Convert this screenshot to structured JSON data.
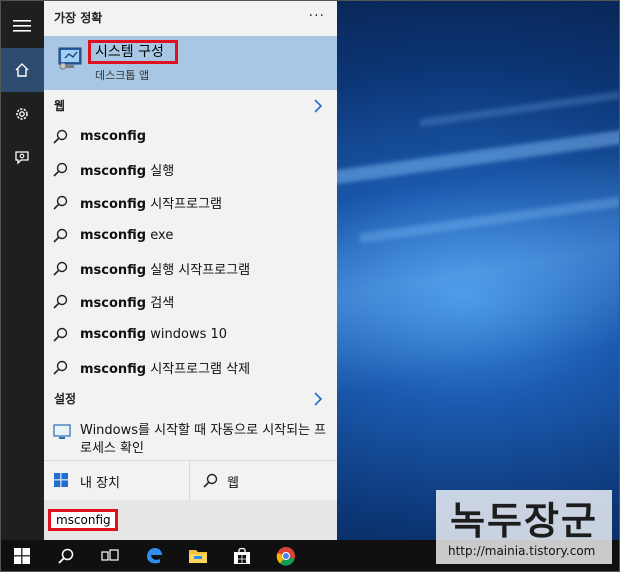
{
  "best_match": {
    "header": "가장 정확",
    "more": "···",
    "title": "시스템 구성",
    "subtitle": "데스크톱 앱"
  },
  "web": {
    "header": "웹",
    "items": [
      {
        "bold": "msconfig",
        "rest": ""
      },
      {
        "bold": "msconfig",
        "rest": " 실행"
      },
      {
        "bold": "msconfig",
        "rest": " 시작프로그램"
      },
      {
        "bold": "msconfig",
        "rest": " exe"
      },
      {
        "bold": "msconfig",
        "rest": " 실행 시작프로그램"
      },
      {
        "bold": "msconfig",
        "rest": " 검색"
      },
      {
        "bold": "msconfig",
        "rest": " windows 10"
      },
      {
        "bold": "msconfig",
        "rest": " 시작프로그램 삭제"
      }
    ]
  },
  "settings": {
    "header": "설정",
    "item": "Windows를 시작할 때 자동으로 시작되는 프로세스 확인"
  },
  "bottom": {
    "my_device": "내 장치",
    "web": "웹"
  },
  "search": {
    "value": "msconfig"
  },
  "watermark": {
    "title": "녹두장군",
    "url": "http://mainia.tistory.com"
  },
  "rail": {
    "icons": [
      "hamburger-icon",
      "home-icon",
      "gear-icon",
      "feedback-icon"
    ]
  },
  "taskbar": {
    "icons": [
      "windows-start-icon",
      "search-icon",
      "task-view-icon",
      "edge-icon",
      "file-explorer-icon",
      "store-icon",
      "chrome-icon"
    ]
  },
  "colors": {
    "highlight": "#a8c7e4",
    "accent_red": "#e0101e",
    "rail_active": "#2c4b6e"
  }
}
